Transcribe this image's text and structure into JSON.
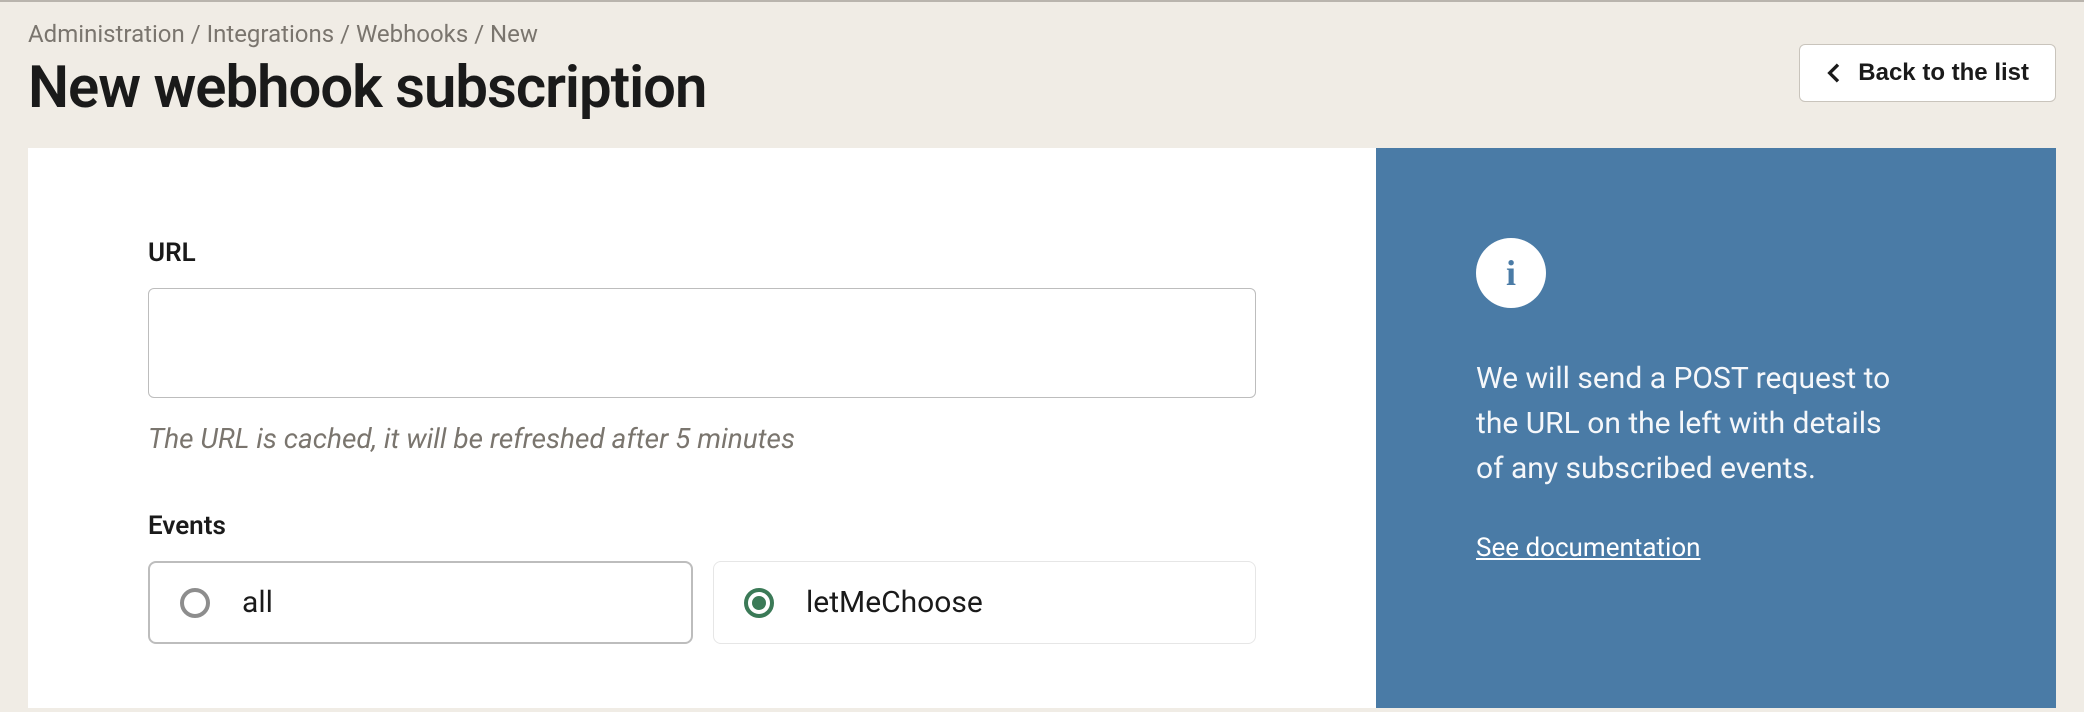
{
  "breadcrumb": {
    "items": [
      "Administration",
      "Integrations",
      "Webhooks",
      "New"
    ],
    "sep": " / "
  },
  "page": {
    "title": "New webhook subscription"
  },
  "header": {
    "back_label": "Back to the list"
  },
  "form": {
    "url": {
      "label": "URL",
      "value": "",
      "help": "The URL is cached, it will be refreshed after 5 minutes"
    },
    "events": {
      "label": "Events",
      "options": [
        {
          "key": "all",
          "label": "all",
          "selected": false
        },
        {
          "key": "letMeChoose",
          "label": "letMeChoose",
          "selected": true
        }
      ]
    }
  },
  "info": {
    "icon": "i",
    "body": "We will send a POST request to the URL on the left with details of any subscribed events.",
    "doc_link": "See documentation"
  }
}
